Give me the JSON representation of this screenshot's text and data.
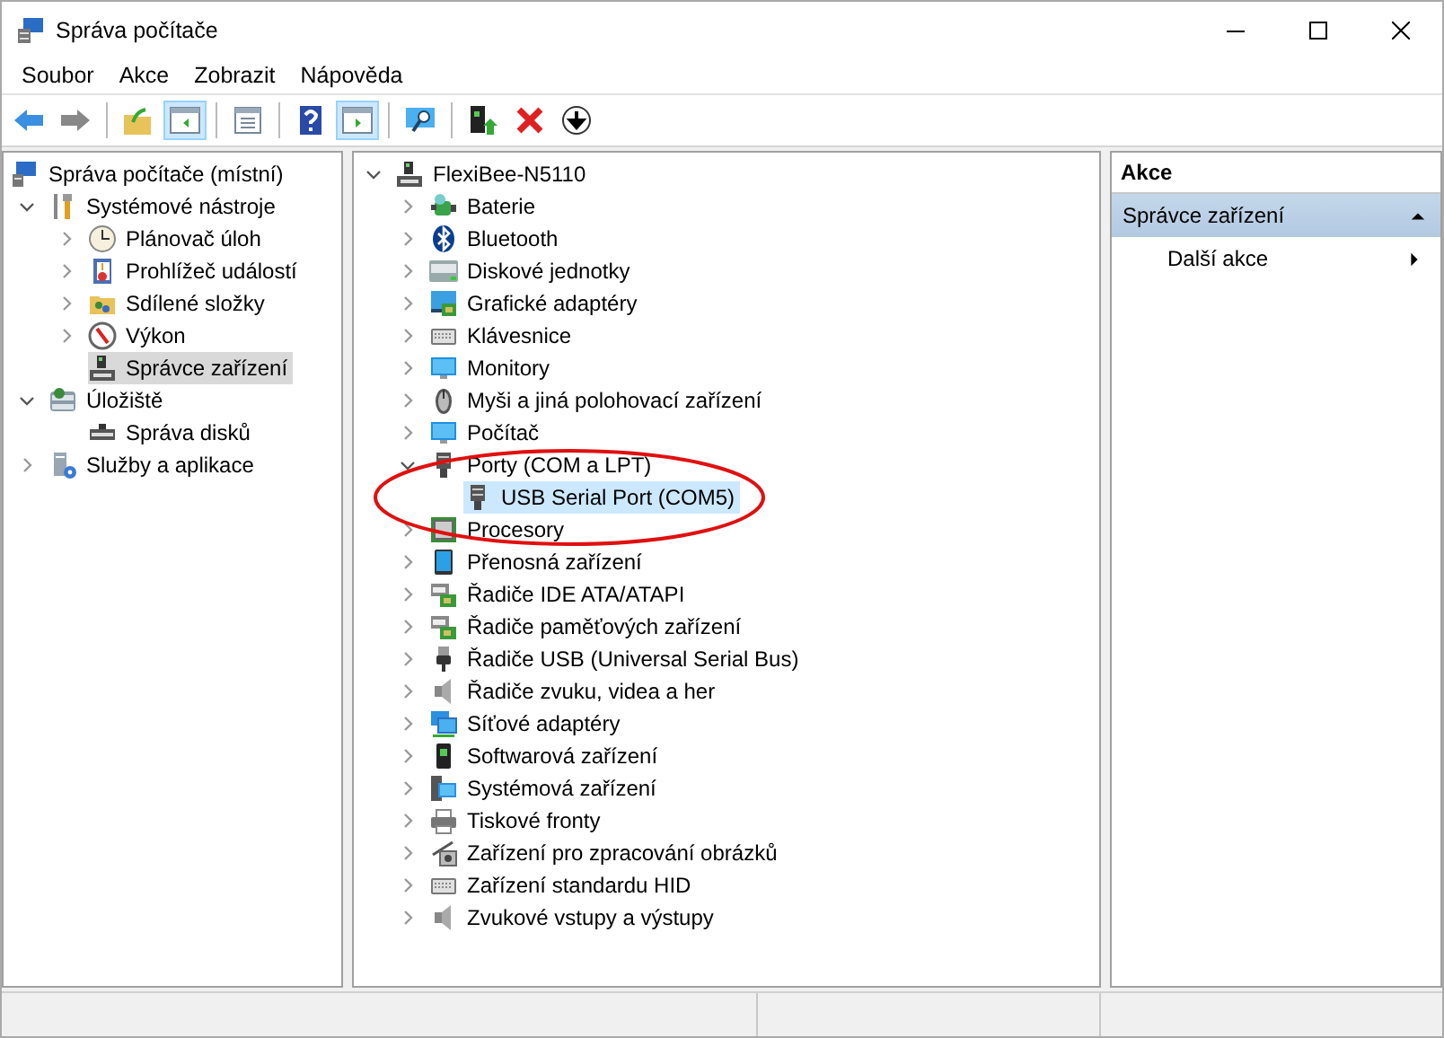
{
  "window": {
    "title": "Správa počítače"
  },
  "menu": [
    "Soubor",
    "Akce",
    "Zobrazit",
    "Nápověda"
  ],
  "toolbar": [
    [
      {
        "pressed": false
      },
      {
        "pressed": false
      }
    ],
    [
      {
        "pressed": false
      },
      {
        "pressed": true
      }
    ],
    [
      {
        "pressed": false
      }
    ],
    [
      {
        "pressed": false
      },
      {
        "pressed": true
      }
    ],
    [
      {
        "pressed": false
      }
    ],
    [
      {
        "pressed": false
      },
      {
        "pressed": false
      },
      {
        "pressed": false
      }
    ]
  ],
  "navigation_tree": {
    "label": "Správa počítače (místní)",
    "selected": false,
    "children": [
      {
        "label": "Systémové nástroje",
        "expanded": true,
        "selected": false,
        "children": [
          {
            "label": "Plánovač úloh",
            "expanded": false,
            "selected": false
          },
          {
            "label": "Prohlížeč událostí",
            "expanded": false,
            "selected": false
          },
          {
            "label": "Sdílené složky",
            "expanded": false,
            "selected": false
          },
          {
            "label": "Výkon",
            "expanded": false,
            "selected": false
          },
          {
            "label": "Správce zařízení",
            "selected": true
          }
        ]
      },
      {
        "label": "Úložiště",
        "expanded": true,
        "selected": false,
        "children": [
          {
            "label": "Správa disků",
            "selected": false
          }
        ]
      },
      {
        "label": "Služby a aplikace",
        "expanded": false,
        "selected": false
      }
    ]
  },
  "device_tree": {
    "label": "FlexiBee-N5110",
    "expanded": true,
    "selected": false,
    "children": [
      {
        "label": "Baterie",
        "expanded": false,
        "selected": false
      },
      {
        "label": "Bluetooth",
        "expanded": false,
        "selected": false
      },
      {
        "label": "Diskové jednotky",
        "expanded": false,
        "selected": false
      },
      {
        "label": "Grafické adaptéry",
        "expanded": false,
        "selected": false
      },
      {
        "label": "Klávesnice",
        "expanded": false,
        "selected": false
      },
      {
        "label": "Monitory",
        "expanded": false,
        "selected": false
      },
      {
        "label": "Myši a jiná polohovací zařízení",
        "expanded": false,
        "selected": false
      },
      {
        "label": "Počítač",
        "expanded": false,
        "selected": false
      },
      {
        "label": "Porty (COM a LPT)",
        "expanded": true,
        "selected": false,
        "children": [
          {
            "label": "USB Serial Port (COM5)",
            "selected": true
          }
        ]
      },
      {
        "label": "Procesory",
        "expanded": false,
        "selected": false
      },
      {
        "label": "Přenosná zařízení",
        "expanded": false,
        "selected": false
      },
      {
        "label": "Řadiče IDE ATA/ATAPI",
        "expanded": false,
        "selected": false
      },
      {
        "label": "Řadiče paměťových zařízení",
        "expanded": false,
        "selected": false
      },
      {
        "label": "Řadiče USB (Universal Serial Bus)",
        "expanded": false,
        "selected": false
      },
      {
        "label": "Řadiče zvuku, videa a her",
        "expanded": false,
        "selected": false
      },
      {
        "label": "Síťové adaptéry",
        "expanded": false,
        "selected": false
      },
      {
        "label": "Softwarová zařízení",
        "expanded": false,
        "selected": false
      },
      {
        "label": "Systémová zařízení",
        "expanded": false,
        "selected": false
      },
      {
        "label": "Tiskové fronty",
        "expanded": false,
        "selected": false
      },
      {
        "label": "Zařízení pro zpracování obrázků",
        "expanded": false,
        "selected": false
      },
      {
        "label": "Zařízení standardu HID",
        "expanded": false,
        "selected": false
      },
      {
        "label": "Zvukové vstupy a výstupy",
        "expanded": false,
        "selected": false
      }
    ]
  },
  "actions_pane": {
    "title": "Akce",
    "section": {
      "label": "Správce zařízení",
      "expanded": true
    },
    "items": [
      "Další akce"
    ]
  }
}
